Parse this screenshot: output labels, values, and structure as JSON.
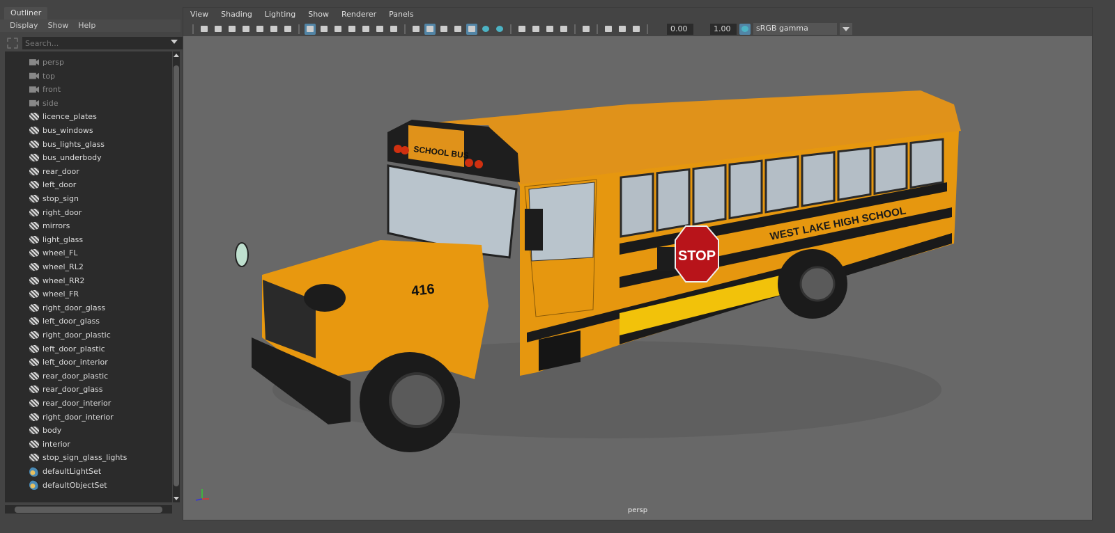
{
  "outliner": {
    "tab": "Outliner",
    "menu": [
      "Display",
      "Show",
      "Help"
    ],
    "search_placeholder": "Search...",
    "items": [
      {
        "label": "persp",
        "type": "cam"
      },
      {
        "label": "top",
        "type": "cam"
      },
      {
        "label": "front",
        "type": "cam"
      },
      {
        "label": "side",
        "type": "cam"
      },
      {
        "label": "licence_plates",
        "type": "mesh"
      },
      {
        "label": "bus_windows",
        "type": "mesh"
      },
      {
        "label": "bus_lights_glass",
        "type": "mesh"
      },
      {
        "label": "bus_underbody",
        "type": "mesh"
      },
      {
        "label": "rear_door",
        "type": "mesh"
      },
      {
        "label": "left_door",
        "type": "mesh"
      },
      {
        "label": "stop_sign",
        "type": "mesh"
      },
      {
        "label": "right_door",
        "type": "mesh"
      },
      {
        "label": "mirrors",
        "type": "mesh"
      },
      {
        "label": "light_glass",
        "type": "mesh"
      },
      {
        "label": "wheel_FL",
        "type": "mesh"
      },
      {
        "label": "wheel_RL2",
        "type": "mesh"
      },
      {
        "label": "wheel_RR2",
        "type": "mesh"
      },
      {
        "label": "wheel_FR",
        "type": "mesh"
      },
      {
        "label": "right_door_glass",
        "type": "mesh"
      },
      {
        "label": "left_door_glass",
        "type": "mesh"
      },
      {
        "label": "right_door_plastic",
        "type": "mesh"
      },
      {
        "label": "left_door_plastic",
        "type": "mesh"
      },
      {
        "label": "left_door_interior",
        "type": "mesh"
      },
      {
        "label": "rear_door_plastic",
        "type": "mesh"
      },
      {
        "label": "rear_door_glass",
        "type": "mesh"
      },
      {
        "label": "rear_door_interior",
        "type": "mesh"
      },
      {
        "label": "right_door_interior",
        "type": "mesh"
      },
      {
        "label": "body",
        "type": "mesh"
      },
      {
        "label": "interior",
        "type": "mesh"
      },
      {
        "label": "stop_sign_glass_lights",
        "type": "mesh"
      },
      {
        "label": "defaultLightSet",
        "type": "set"
      },
      {
        "label": "defaultObjectSet",
        "type": "set"
      }
    ]
  },
  "viewport": {
    "menu": [
      "View",
      "Shading",
      "Lighting",
      "Show",
      "Renderer",
      "Panels"
    ],
    "toolbar_groups": [
      [
        "camera-icon",
        "lock-camera-icon",
        "camera-attributes-icon",
        "bookmark-icon",
        "image-plane-icon",
        "2d-pan-zoom-icon",
        "grease-pencil-icon"
      ],
      [
        "grid-icon",
        "film-gate-icon",
        "resolution-gate-icon",
        "gate-mask-icon",
        "field-chart-icon",
        "safe-action-icon",
        "safe-title-icon"
      ],
      [
        "wireframe-icon",
        "smooth-shade-icon",
        "default-material-icon",
        "wireframe-on-shaded-icon",
        "textured-icon",
        "lights-icon",
        "shadows-icon"
      ],
      [
        "ambient-occlusion-icon",
        "motion-blur-icon",
        "anti-aliasing-icon",
        "depth-of-field-icon"
      ],
      [
        "isolate-select-icon"
      ],
      [
        "xray-icon",
        "xray-joints-icon",
        "xray-components-icon"
      ]
    ],
    "active_icons": [
      "grid-icon",
      "smooth-shade-icon",
      "textured-icon"
    ],
    "exposure": "0.00",
    "gamma": "1.00",
    "color_management": "sRGB gamma",
    "camera_label": "persp"
  },
  "model": {
    "sign_text": "SCHOOL BUS",
    "bus_number": "416",
    "side_text": "WEST LAKE HIGH SCHOOL",
    "stop_text": "STOP"
  },
  "colors": {
    "bus_yellow": "#e89a12",
    "stripe": "#1a1a1a",
    "viewport_bg": "#686868",
    "accent": "#5285a6"
  }
}
